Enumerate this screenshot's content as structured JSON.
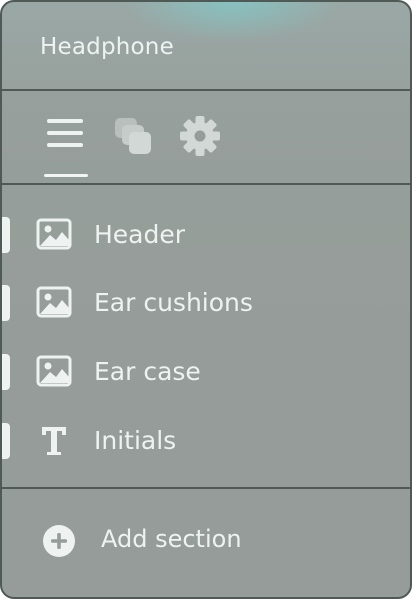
{
  "panel": {
    "title": "Headphone"
  },
  "tabs": [
    {
      "icon": "list-icon",
      "active": true
    },
    {
      "icon": "layers-icon",
      "active": false
    },
    {
      "icon": "settings-gear-icon",
      "active": false
    }
  ],
  "sections": [
    {
      "label": "Header",
      "icon": "image-icon"
    },
    {
      "label": "Ear cushions",
      "icon": "image-icon"
    },
    {
      "label": "Ear case",
      "icon": "image-icon"
    },
    {
      "label": "Initials",
      "icon": "text-icon"
    }
  ],
  "add_section": {
    "label": "Add section",
    "icon": "plus-circle-icon"
  },
  "colors": {
    "panel_border": "#4f5a57",
    "panel_bg": "#959c99",
    "text": "#eef3f2",
    "accent_glow": "#78d7d7"
  }
}
